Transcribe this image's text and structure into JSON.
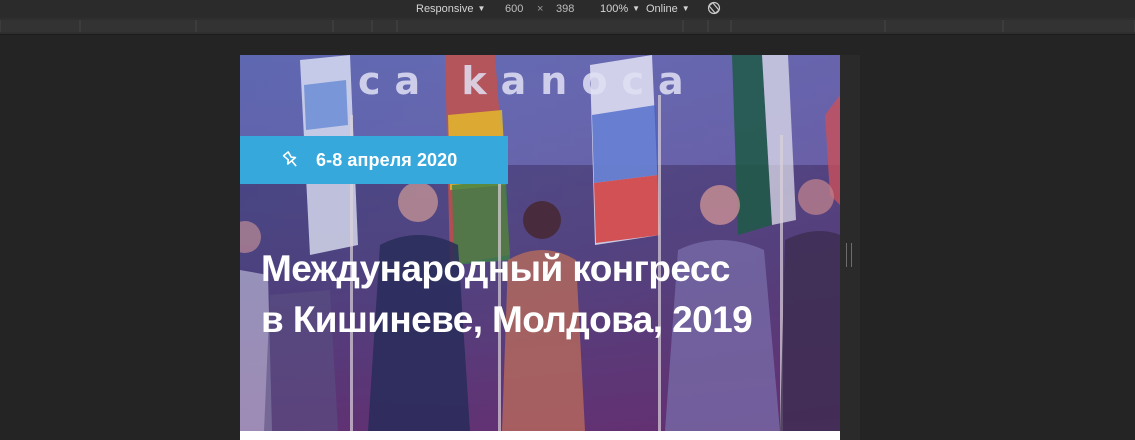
{
  "devtools": {
    "device_mode": "Responsive",
    "width": "600",
    "separator": "×",
    "height": "398",
    "zoom": "100%",
    "network": "Online"
  },
  "hero": {
    "date": "6-8 апреля 2020",
    "title_line1": "Международный конгресс",
    "title_line2": "в Кишиневе, Молдова, 2019",
    "sign_text": "ca kanoca"
  },
  "colors": {
    "badge": "#37a8dc",
    "toolbar": "#2b2b2b",
    "background": "#242424"
  }
}
